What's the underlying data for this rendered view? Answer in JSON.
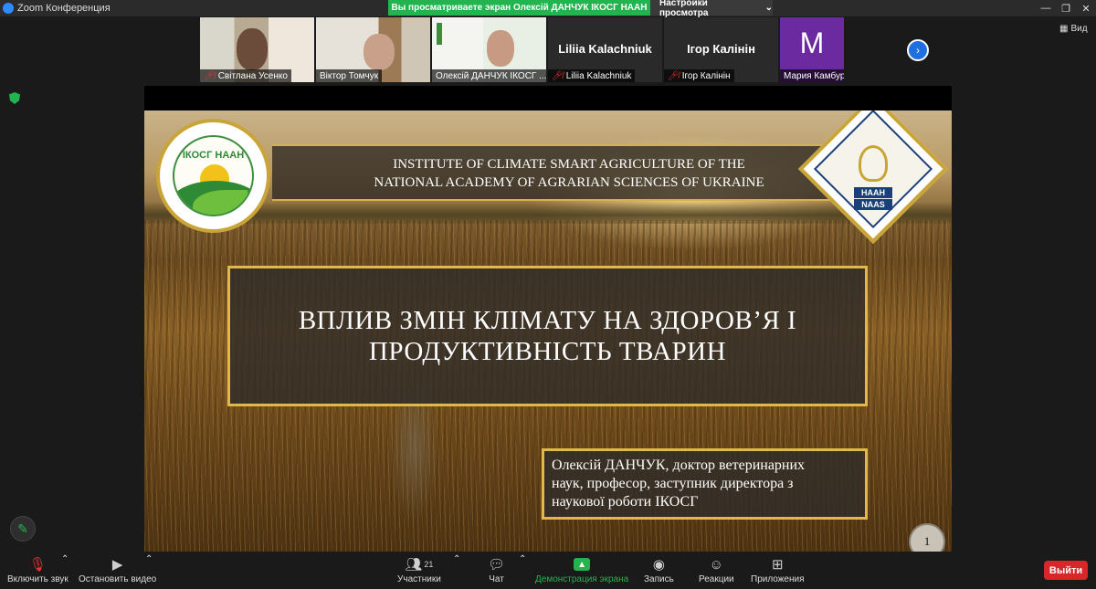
{
  "window": {
    "title": "Zoom Конференция"
  },
  "share_banner": "Вы просматриваете экран Олексій ДАНЧУК ІКОСГ НААН",
  "view_options": {
    "label": "Настройки просмотра",
    "caret": "⌄"
  },
  "view_button": {
    "label": "Вид"
  },
  "participants": [
    {
      "name": "Світлана Усенко",
      "muted": true
    },
    {
      "name": "Віктор Томчук",
      "muted": false
    },
    {
      "name": "Олексій ДАНЧУК ІКОСГ ...",
      "muted": false
    },
    {
      "name": "Liliia Kalachniuk",
      "big_name": "Liliia Kalachniuk",
      "muted": true
    },
    {
      "name": "Ігор Калінін",
      "big_name": "Ігор Калінін",
      "muted": true
    },
    {
      "name": "Мария Камбур",
      "avatar_letter": "M",
      "muted": false
    }
  ],
  "slide": {
    "band_line1": "INSTITUTE OF CLIMATE SMART AGRICULTURE OF THE",
    "band_line2": "NATIONAL ACADEMY OF AGRARIAN SCIENCES OF UKRAINE",
    "left_logo": "ІКОСГ НААН",
    "right_logo_l1": "НААН",
    "right_logo_l2": "NAAS",
    "title_line1": "ВПЛИВ ЗМІН КЛІМАТУ НА ЗДОРОВ’Я  І",
    "title_line2": "ПРОДУКТИВНІСТЬ ТВАРИН",
    "author_line1": "Олексій ДАНЧУК, доктор ветеринарних",
    "author_line2": "наук, професор, заступник директора з",
    "author_line3": "наукової роботи ІКОСГ",
    "page_number": "1"
  },
  "toolbar": {
    "audio": "Включить звук",
    "video": "Остановить видео",
    "participants": "Участники",
    "participants_count": "21",
    "chat": "Чат",
    "share": "Демонстрация экрана",
    "record": "Запись",
    "reactions": "Реакции",
    "apps": "Приложения",
    "leave": "Выйти"
  },
  "colors": {
    "share_green": "#23b450",
    "leave_red": "#d6272b",
    "accent_gold": "#e1b84a"
  }
}
